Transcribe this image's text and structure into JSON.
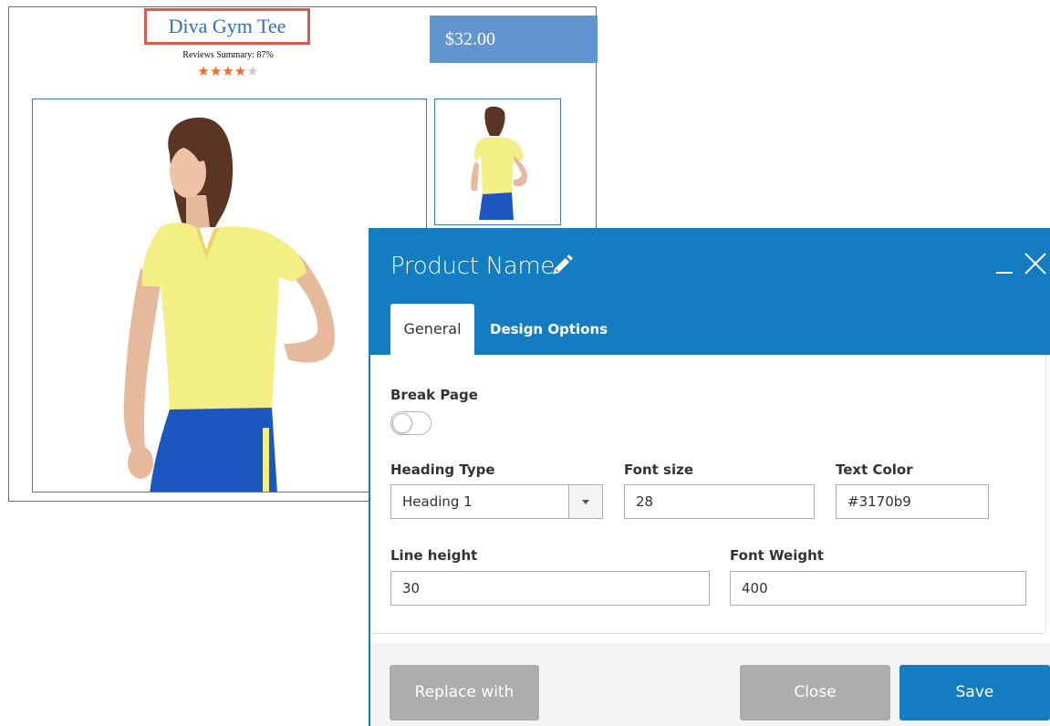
{
  "product_card": {
    "name": "Diva Gym Tee",
    "reviews_summary": "Reviews Summary: 87%",
    "rating": {
      "filled": 4,
      "total": 5
    },
    "price": "$32.00",
    "colors": {
      "title": "#3170b9",
      "price_bg": "#6195d0",
      "star": "#f06a2a",
      "highlight_border": "#e2574c"
    }
  },
  "modal": {
    "title": "Product Name",
    "title_icon": "pencil-icon",
    "window_controls": {
      "minimize": "minimize-icon",
      "close": "close-icon"
    },
    "tabs": [
      {
        "label": "General",
        "active": true
      },
      {
        "label": "Design Options",
        "active": false
      }
    ],
    "fields": {
      "break_page": {
        "label": "Break Page",
        "on": false
      },
      "heading_type": {
        "label": "Heading Type",
        "value": "Heading 1"
      },
      "font_size": {
        "label": "Font size",
        "value": "28"
      },
      "text_color": {
        "label": "Text Color",
        "value": "#3170b9"
      },
      "line_height": {
        "label": "Line height",
        "value": "30"
      },
      "font_weight": {
        "label": "Font Weight",
        "value": "400"
      }
    },
    "footer": {
      "replace_label": "Replace with",
      "close_label": "Close",
      "save_label": "Save"
    },
    "colors": {
      "header_bg": "#147dc1",
      "save_bg": "#147dc1",
      "secondary_btn_bg": "#adadad"
    }
  }
}
